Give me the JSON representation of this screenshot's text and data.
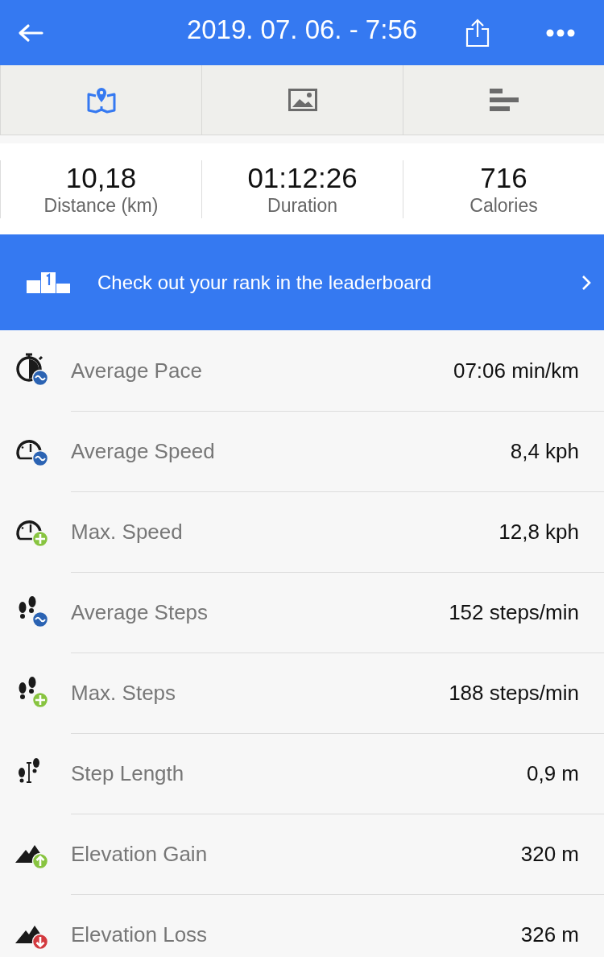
{
  "header": {
    "title": "2019. 07. 06. - 7:56"
  },
  "tabs": [
    {
      "kind": "map",
      "selected": true
    },
    {
      "kind": "photo",
      "selected": false
    },
    {
      "kind": "bars",
      "selected": false
    }
  ],
  "summary": [
    {
      "value": "10,18",
      "label": "Distance (km)"
    },
    {
      "value": "01:12:26",
      "label": "Duration"
    },
    {
      "value": "716",
      "label": "Calories"
    }
  ],
  "banner": {
    "text": "Check out your rank in the leaderboard"
  },
  "metrics": [
    {
      "label": "Average Pace",
      "value": "07:06 min/km"
    },
    {
      "label": "Average Speed",
      "value": "8,4 kph"
    },
    {
      "label": "Max. Speed",
      "value": "12,8 kph"
    },
    {
      "label": "Average Steps",
      "value": "152 steps/min"
    },
    {
      "label": "Max. Steps",
      "value": "188 steps/min"
    },
    {
      "label": "Step Length",
      "value": "0,9 m"
    },
    {
      "label": "Elevation Gain",
      "value": "320 m"
    },
    {
      "label": "Elevation Loss",
      "value": "326 m"
    }
  ]
}
